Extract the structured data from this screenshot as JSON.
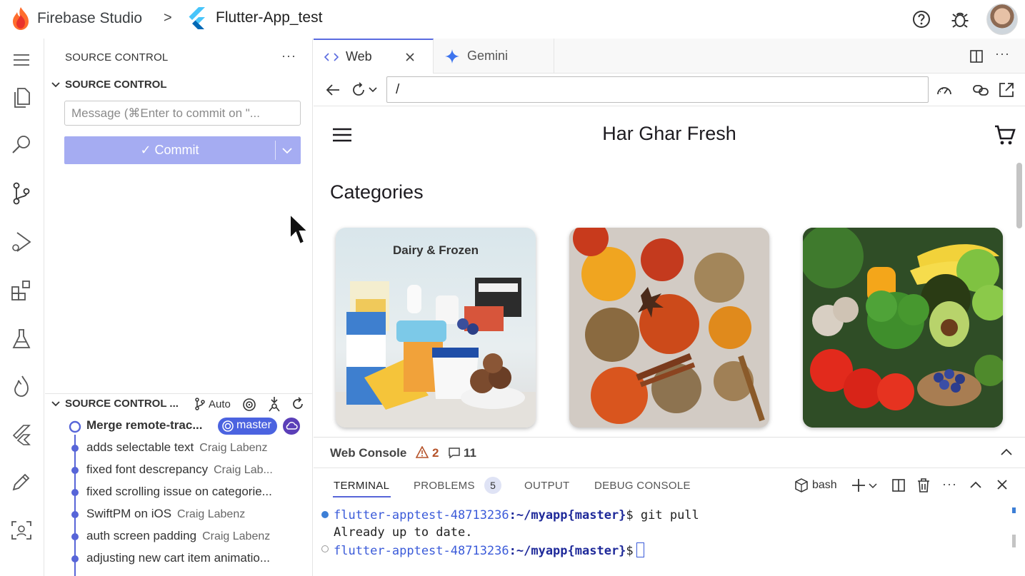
{
  "topbar": {
    "brand": "Firebase Studio",
    "separator": ">",
    "project": "Flutter-App_test"
  },
  "scm": {
    "panel_title": "SOURCE CONTROL",
    "more": "···",
    "section_title": "SOURCE CONTROL",
    "message_placeholder": "Message (⌘Enter to commit on \"...",
    "commit_label": "✓ Commit",
    "graph_title": "SOURCE CONTROL ...",
    "graph_auto": "Auto",
    "commits": [
      {
        "message": "Merge remote-trac...",
        "author": "",
        "branch": "master"
      },
      {
        "message": "adds selectable text",
        "author": "Craig Labenz"
      },
      {
        "message": "fixed font descrepancy",
        "author": "Craig Lab..."
      },
      {
        "message": "fixed scrolling issue on categorie...",
        "author": ""
      },
      {
        "message": "SwiftPM on iOS",
        "author": "Craig Labenz"
      },
      {
        "message": "auth screen padding",
        "author": "Craig Labenz"
      },
      {
        "message": "adjusting new cart item animatio...",
        "author": ""
      }
    ]
  },
  "tabs": [
    {
      "label": "Web",
      "icon": "code-icon"
    },
    {
      "label": "Gemini",
      "icon": "gemini-icon"
    }
  ],
  "urlbar": {
    "url": "/"
  },
  "app": {
    "title": "Har Ghar Fresh",
    "categories_title": "Categories",
    "cards": [
      {
        "title": "Dairy & Frozen"
      },
      {
        "title": ""
      },
      {
        "title": ""
      }
    ]
  },
  "webconsole": {
    "title": "Web Console",
    "warnings": "2",
    "messages": "11"
  },
  "terminal": {
    "tabs": [
      "TERMINAL",
      "PROBLEMS",
      "OUTPUT",
      "DEBUG CONSOLE"
    ],
    "problems_count": "5",
    "shell": "bash",
    "lines": [
      {
        "user": "flutter-apptest-48713236",
        "path": ":~/myapp",
        "branch": "{master}",
        "cmd": "$ git pull"
      },
      {
        "output": "Already up to date."
      },
      {
        "user": "flutter-apptest-48713236",
        "path": ":~/myapp",
        "branch": "{master}",
        "cmd": "$"
      }
    ]
  },
  "colors": {
    "accent": "#5765d8",
    "commit_button": "#a5acf2",
    "master_badge": "#4b63e0",
    "warning": "#b5532a"
  }
}
